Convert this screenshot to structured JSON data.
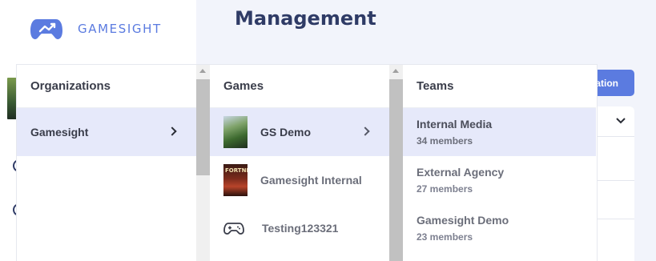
{
  "brand": {
    "name": "GAMESIGHT",
    "logo_icon": "gamepad-chart-icon",
    "color": "#5b7be0"
  },
  "header": {
    "title": "Management"
  },
  "background": {
    "action_button_label": "ization"
  },
  "dropdown": {
    "organizations": {
      "header": "Organizations",
      "items": [
        {
          "label": "Gamesight",
          "selected": true
        }
      ]
    },
    "games": {
      "header": "Games",
      "items": [
        {
          "label": "GS Demo",
          "icon": "gs-demo-thumbnail",
          "selected": true
        },
        {
          "label": "Gamesight Internal",
          "icon": "fortnite-thumbnail",
          "thumb_text": "FORTNITE"
        },
        {
          "label": "Testing123321",
          "icon": "gamepad-icon"
        }
      ]
    },
    "teams": {
      "header": "Teams",
      "items": [
        {
          "name": "Internal Media",
          "members": "34 members",
          "selected": true
        },
        {
          "name": "External Agency",
          "members": "27 members"
        },
        {
          "name": "Gamesight Demo",
          "members": "23 members"
        }
      ]
    }
  },
  "colors": {
    "accent": "#5b7be0",
    "selected_bg": "#e6e9fa",
    "title": "#2f3b66"
  }
}
